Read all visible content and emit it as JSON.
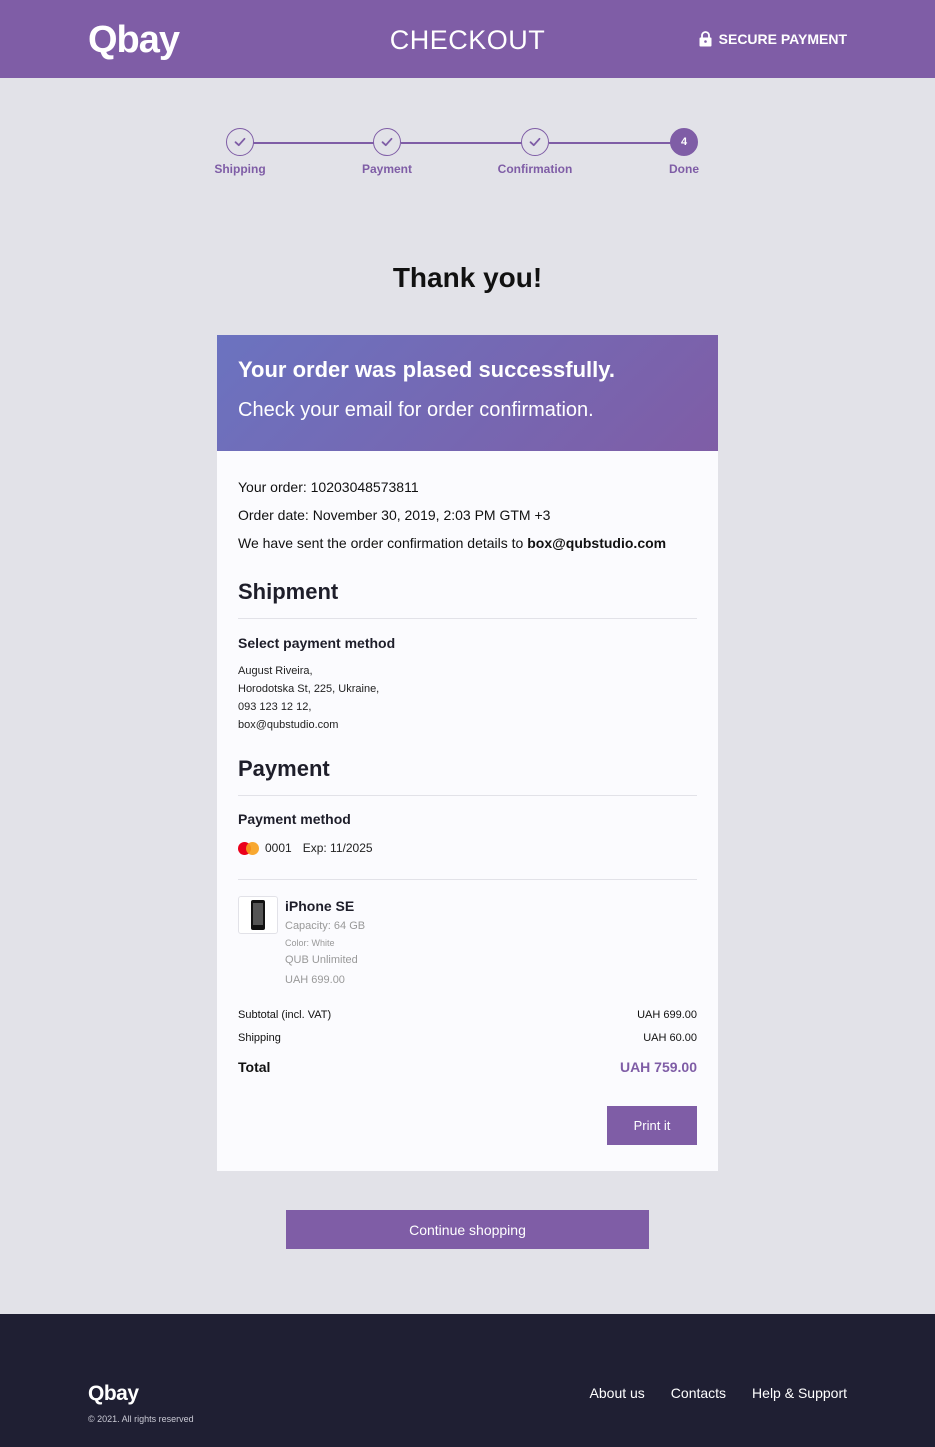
{
  "header": {
    "logo": "Qbay",
    "title": "CHECKOUT",
    "secure_label": "SECURE PAYMENT"
  },
  "stepper": {
    "steps": [
      {
        "label": "Shipping",
        "state": "done"
      },
      {
        "label": "Payment",
        "state": "done"
      },
      {
        "label": "Confirmation",
        "state": "done"
      },
      {
        "label": "Done",
        "state": "current",
        "number": "4"
      }
    ]
  },
  "thanks": "Thank you!",
  "banner": {
    "title": "Your order was plased successfully.",
    "subtitle": "Check your email for order confirmation."
  },
  "order": {
    "number_line": "Your order: 10203048573811",
    "date_line": "Order date: November 30, 2019, 2:03 PM GTM +3",
    "sent_prefix": "We have sent the order confirmation details to ",
    "sent_email": "box@qubstudio.com"
  },
  "shipment": {
    "title": "Shipment",
    "subtitle": "Select payment method",
    "address_lines": [
      "August Riveira,",
      "Horodotska St, 225, Ukraine,",
      "093 123 12 12,",
      "box@qubstudio.com"
    ]
  },
  "payment": {
    "title": "Payment",
    "subtitle": "Payment method",
    "card_last": "0001",
    "card_exp": "Exp: 11/2025"
  },
  "product": {
    "name": "iPhone SE",
    "capacity": "Capacity: 64 GB",
    "color": "Color: White",
    "plan": "QUB Unlimited",
    "price": "UAH 699.00"
  },
  "summary": {
    "subtotal_label": "Subtotal (incl. VAT)",
    "subtotal_value": "UAH 699.00",
    "shipping_label": "Shipping",
    "shipping_value": "UAH 60.00",
    "total_label": "Total",
    "total_value": "UAH 759.00"
  },
  "buttons": {
    "print": "Print it",
    "continue": "Continue shopping"
  },
  "footer": {
    "logo": "Qbay",
    "copyright": "© 2021. All rights reserved",
    "links": [
      "About us",
      "Contacts",
      "Help & Support"
    ]
  },
  "colors": {
    "accent": "#7f5da6",
    "background": "#e2e2e8",
    "footer": "#1f1f33"
  }
}
